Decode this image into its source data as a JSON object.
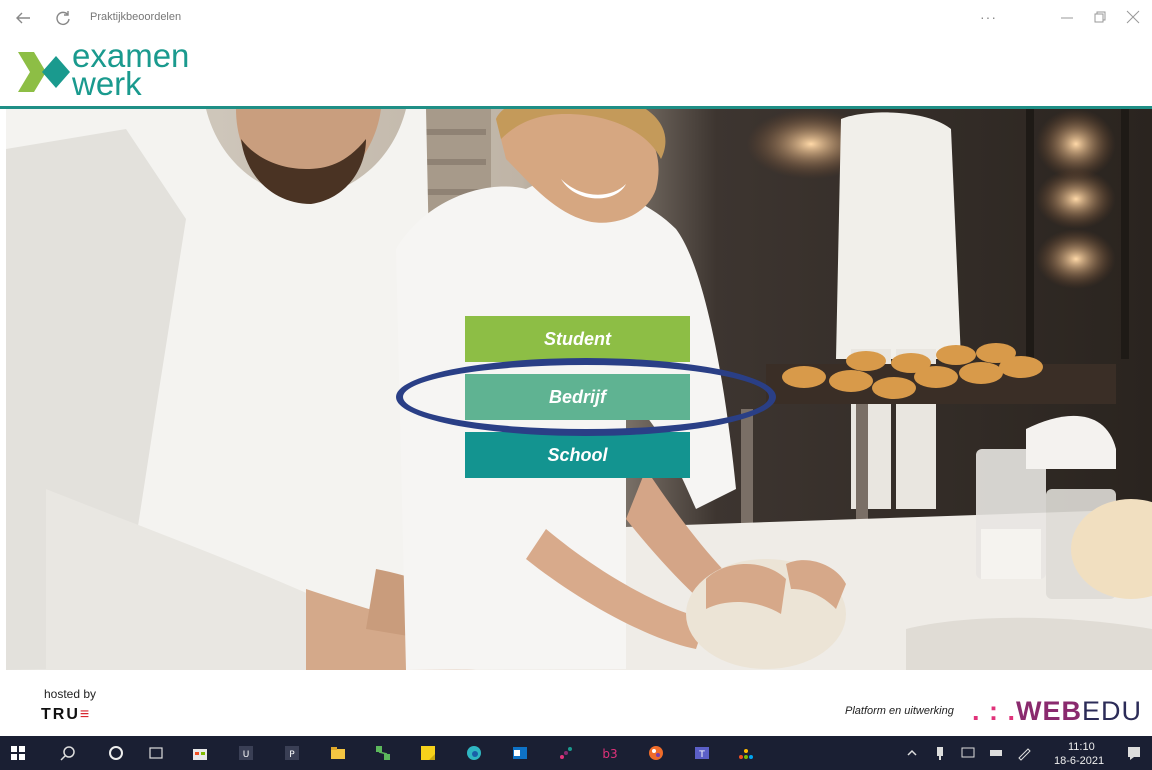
{
  "window": {
    "title": "Praktijkbeoordelen",
    "more": "···"
  },
  "brand": {
    "logo_line1": "examen",
    "logo_line2": "werk"
  },
  "buttons": {
    "student": "Student",
    "bedrijf": "Bedrijf",
    "school": "School"
  },
  "footer": {
    "hosted_by": "hosted by",
    "host_brand_main": "TRU",
    "host_brand_accent": "≡",
    "platform_label": "Platform en uitwerking",
    "partner_dots": ". : .",
    "partner_web": "WEB",
    "partner_edu": "EDU"
  },
  "taskbar": {
    "time": "11:10",
    "date": "18-6-2021",
    "pinned": [
      "windows-start",
      "search",
      "cortana",
      "task-view",
      "store",
      "u-app",
      "p-app",
      "file-explorer",
      "network-app",
      "sticky-notes",
      "edge",
      "outlook",
      "dots-app",
      "b3-app",
      "paint-app",
      "teams",
      "colorful-app"
    ]
  },
  "colors": {
    "brand_teal": "#1a9a8e",
    "student_green": "#8dbe45",
    "bedrijf_green": "#5fb392",
    "school_teal": "#139490",
    "highlight_navy": "#2a3f86",
    "taskbar": "#1a1f33"
  }
}
